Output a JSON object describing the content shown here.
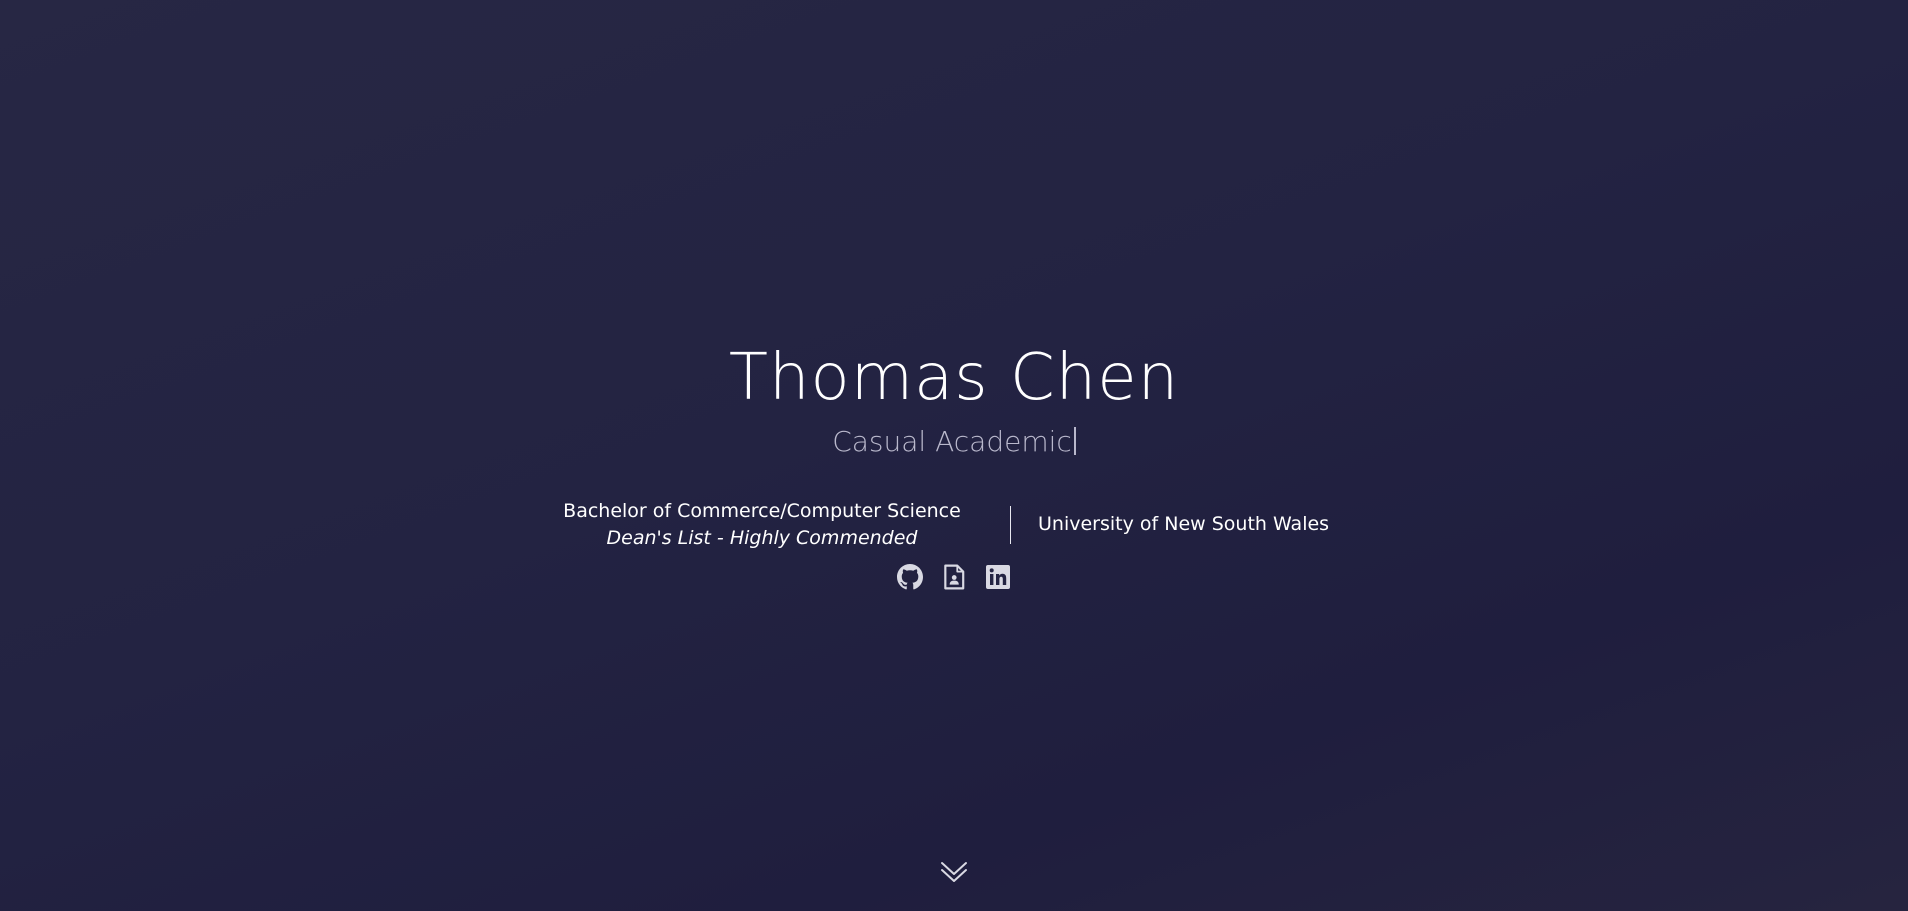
{
  "hero": {
    "name": "Thomas Chen",
    "subtitle": "Casual Academic"
  },
  "education": {
    "degree": "Bachelor of Commerce/Computer Science",
    "honours": "Dean's List - Highly Commended",
    "university": "University of New South Wales"
  },
  "social_links": [
    {
      "icon": "github-icon"
    },
    {
      "icon": "resume-icon"
    },
    {
      "icon": "linkedin-icon"
    }
  ],
  "scroll": {
    "icon": "double-chevron-down-icon"
  },
  "colors": {
    "background": "#232342",
    "text": "#ffffff",
    "subtitle": "#b9b8cc",
    "icon": "#d9d9e3"
  }
}
